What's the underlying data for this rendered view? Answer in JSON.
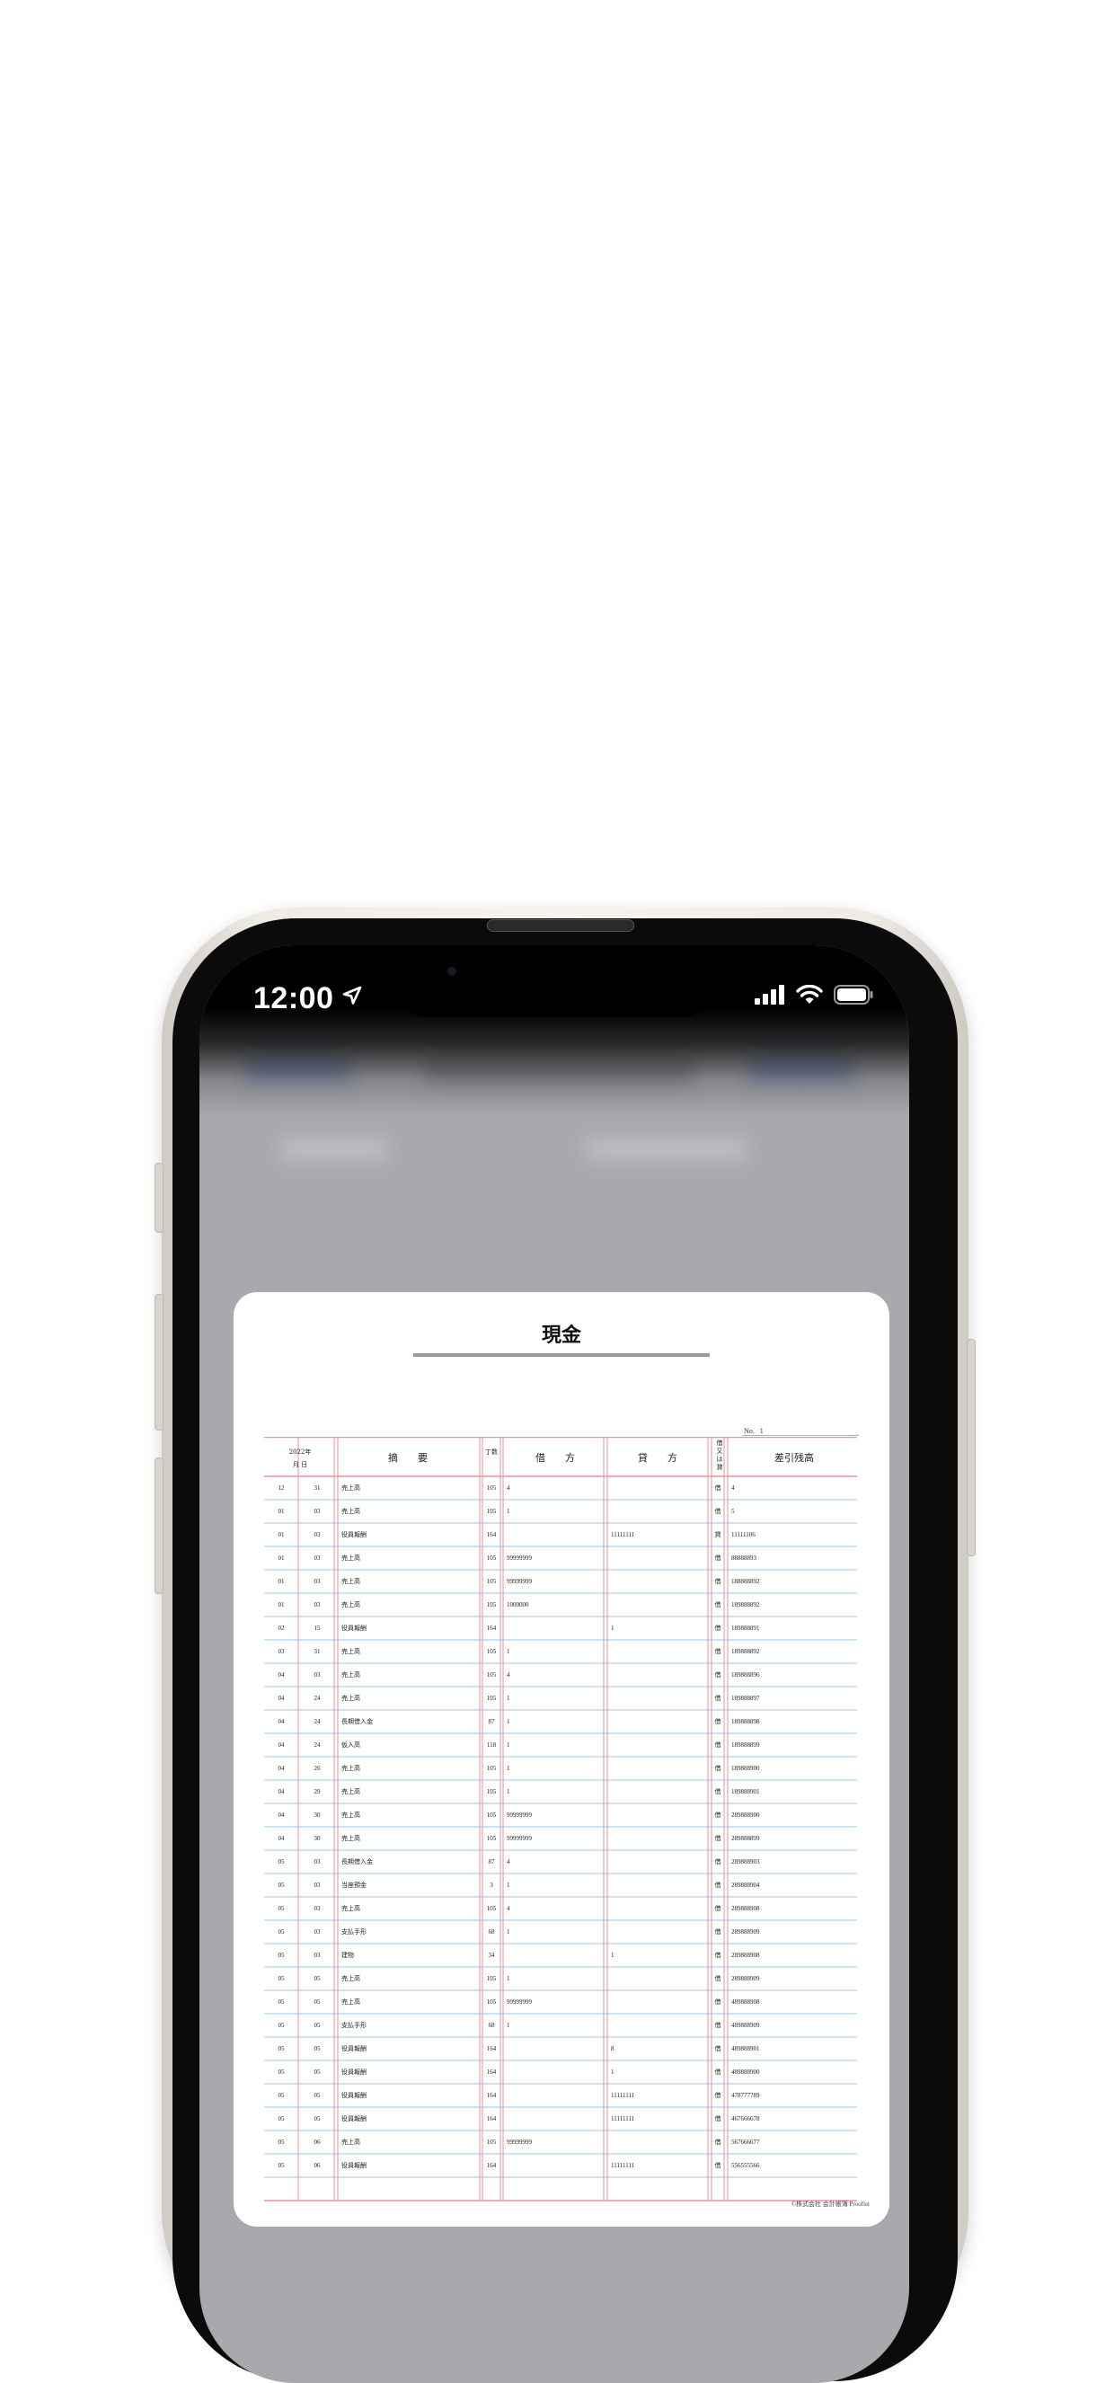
{
  "status_bar": {
    "time": "12:00",
    "location_icon": "location-arrow-icon",
    "signal_icon": "cellular-signal-icon",
    "wifi_icon": "wifi-icon",
    "battery_icon": "battery-icon"
  },
  "document": {
    "title": "現金",
    "page_no_label": "No.",
    "page_no": "1",
    "header": {
      "year": "2022年",
      "month_day": "月 日",
      "summary": "摘　　要",
      "folio": "丁数",
      "debit": "借　　方",
      "credit": "貸　　方",
      "dc": "借又は貸",
      "balance": "差引残高"
    },
    "rows": [
      {
        "m": "12",
        "d": "31",
        "summary": "売上高",
        "folio": "105",
        "debit": "4",
        "credit": "",
        "dc": "借",
        "balance": "4"
      },
      {
        "m": "01",
        "d": "03",
        "summary": "売上高",
        "folio": "105",
        "debit": "1",
        "credit": "",
        "dc": "借",
        "balance": "5"
      },
      {
        "m": "01",
        "d": "03",
        "summary": "役員報酬",
        "folio": "164",
        "debit": "",
        "credit": "11111111",
        "dc": "貸",
        "balance": "11111106"
      },
      {
        "m": "01",
        "d": "03",
        "summary": "売上高",
        "folio": "105",
        "debit": "99999999",
        "credit": "",
        "dc": "借",
        "balance": "88888893"
      },
      {
        "m": "01",
        "d": "03",
        "summary": "売上高",
        "folio": "105",
        "debit": "99999999",
        "credit": "",
        "dc": "借",
        "balance": "188888892"
      },
      {
        "m": "01",
        "d": "03",
        "summary": "売上高",
        "folio": "105",
        "debit": "1000000",
        "credit": "",
        "dc": "借",
        "balance": "189888892"
      },
      {
        "m": "02",
        "d": "15",
        "summary": "役員報酬",
        "folio": "164",
        "debit": "",
        "credit": "1",
        "dc": "借",
        "balance": "189888891"
      },
      {
        "m": "03",
        "d": "31",
        "summary": "売上高",
        "folio": "105",
        "debit": "1",
        "credit": "",
        "dc": "借",
        "balance": "189888892"
      },
      {
        "m": "04",
        "d": "03",
        "summary": "売上高",
        "folio": "105",
        "debit": "4",
        "credit": "",
        "dc": "借",
        "balance": "189888896"
      },
      {
        "m": "04",
        "d": "24",
        "summary": "売上高",
        "folio": "105",
        "debit": "1",
        "credit": "",
        "dc": "借",
        "balance": "189888897"
      },
      {
        "m": "04",
        "d": "24",
        "summary": "長期借入金",
        "folio": "87",
        "debit": "1",
        "credit": "",
        "dc": "借",
        "balance": "189888898"
      },
      {
        "m": "04",
        "d": "24",
        "summary": "仮入高",
        "folio": "118",
        "debit": "1",
        "credit": "",
        "dc": "借",
        "balance": "189888899"
      },
      {
        "m": "04",
        "d": "26",
        "summary": "売上高",
        "folio": "105",
        "debit": "1",
        "credit": "",
        "dc": "借",
        "balance": "189888900"
      },
      {
        "m": "04",
        "d": "29",
        "summary": "売上高",
        "folio": "105",
        "debit": "1",
        "credit": "",
        "dc": "借",
        "balance": "189888901"
      },
      {
        "m": "04",
        "d": "30",
        "summary": "売上高",
        "folio": "105",
        "debit": "99999999",
        "credit": "",
        "dc": "借",
        "balance": "289888900"
      },
      {
        "m": "04",
        "d": "30",
        "summary": "売上高",
        "folio": "105",
        "debit": "99999999",
        "credit": "",
        "dc": "借",
        "balance": "289888899"
      },
      {
        "m": "05",
        "d": "03",
        "summary": "長期借入金",
        "folio": "87",
        "debit": "4",
        "credit": "",
        "dc": "借",
        "balance": "289888903"
      },
      {
        "m": "05",
        "d": "03",
        "summary": "当座預金",
        "folio": "3",
        "debit": "1",
        "credit": "",
        "dc": "借",
        "balance": "289888904"
      },
      {
        "m": "05",
        "d": "03",
        "summary": "売上高",
        "folio": "105",
        "debit": "4",
        "credit": "",
        "dc": "借",
        "balance": "289888908"
      },
      {
        "m": "05",
        "d": "03",
        "summary": "支払手形",
        "folio": "68",
        "debit": "1",
        "credit": "",
        "dc": "借",
        "balance": "289888909"
      },
      {
        "m": "05",
        "d": "03",
        "summary": "建物",
        "folio": "34",
        "debit": "",
        "credit": "1",
        "dc": "借",
        "balance": "289888908"
      },
      {
        "m": "05",
        "d": "05",
        "summary": "売上高",
        "folio": "105",
        "debit": "1",
        "credit": "",
        "dc": "借",
        "balance": "289888909"
      },
      {
        "m": "05",
        "d": "05",
        "summary": "売上高",
        "folio": "105",
        "debit": "99999999",
        "credit": "",
        "dc": "借",
        "balance": "489888908"
      },
      {
        "m": "05",
        "d": "05",
        "summary": "支払手形",
        "folio": "68",
        "debit": "1",
        "credit": "",
        "dc": "借",
        "balance": "489888909"
      },
      {
        "m": "05",
        "d": "05",
        "summary": "役員報酬",
        "folio": "164",
        "debit": "",
        "credit": "8",
        "dc": "借",
        "balance": "489888901"
      },
      {
        "m": "05",
        "d": "05",
        "summary": "役員報酬",
        "folio": "164",
        "debit": "",
        "credit": "1",
        "dc": "借",
        "balance": "489888900"
      },
      {
        "m": "05",
        "d": "05",
        "summary": "役員報酬",
        "folio": "164",
        "debit": "",
        "credit": "11111111",
        "dc": "借",
        "balance": "478777789"
      },
      {
        "m": "05",
        "d": "05",
        "summary": "役員報酬",
        "folio": "164",
        "debit": "",
        "credit": "11111111",
        "dc": "借",
        "balance": "467666678"
      },
      {
        "m": "05",
        "d": "06",
        "summary": "売上高",
        "folio": "105",
        "debit": "99999999",
        "credit": "",
        "dc": "借",
        "balance": "567666677"
      },
      {
        "m": "05",
        "d": "06",
        "summary": "役員報酬",
        "folio": "164",
        "debit": "",
        "credit": "11111111",
        "dc": "借",
        "balance": "556555566"
      }
    ],
    "footer": "©株式会社 会計帳簿 Prooflet"
  }
}
